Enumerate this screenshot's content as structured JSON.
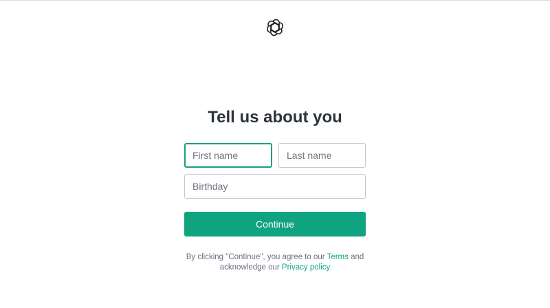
{
  "brand": {
    "logo_icon": "openai-logo-icon",
    "accent_color": "#10a37f"
  },
  "page": {
    "title": "Tell us about you"
  },
  "form": {
    "first_name": {
      "placeholder": "First name",
      "value": ""
    },
    "last_name": {
      "placeholder": "Last name",
      "value": ""
    },
    "birthday": {
      "placeholder": "Birthday",
      "value": ""
    },
    "continue_label": "Continue"
  },
  "legal": {
    "text_before_terms": "By clicking \"Continue\", you agree to our",
    "terms_label": "Terms",
    "text_between": "and acknowledge our",
    "privacy_label": "Privacy policy"
  }
}
